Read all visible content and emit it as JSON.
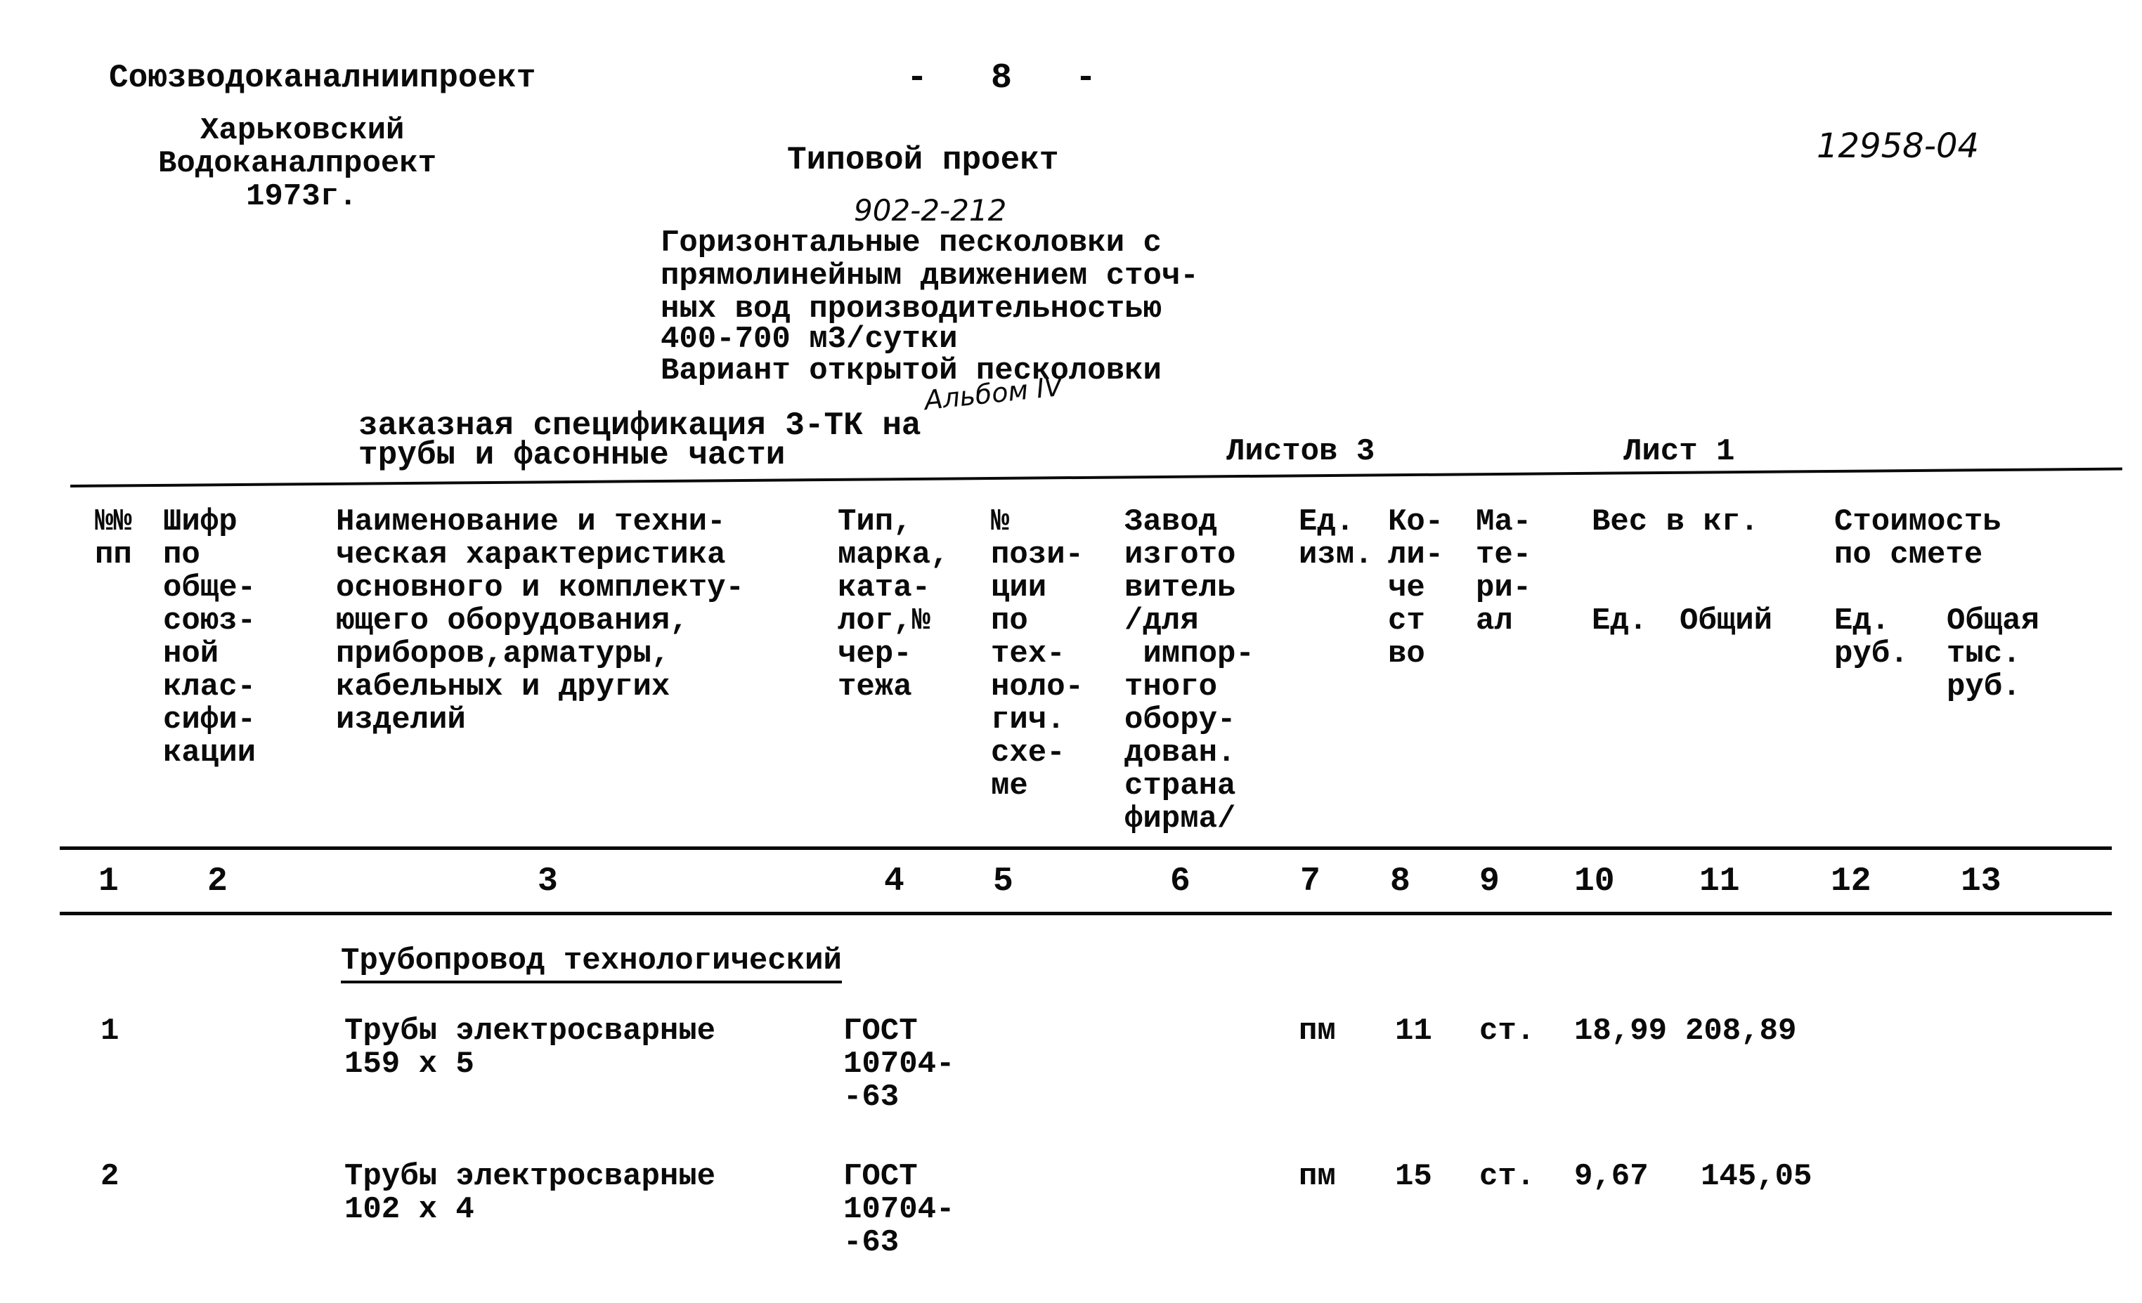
{
  "header": {
    "organization": "Союзводоканалниипроект",
    "page_number": "-   8   -",
    "branch_lines": [
      "Харьковский",
      "Водоканалпроект",
      "1973г."
    ],
    "doc_type": "Типовой проект",
    "project_number_handwritten": "902-2-212",
    "archive_code_handwritten": "12958-04",
    "title_lines": [
      "Горизонтальные песколовки с",
      "прямолинейным движением сточ-",
      "ных вод производительностью",
      "400-700 м3/сутки",
      "Вариант открытой песколовки"
    ],
    "album_handwritten": "Альбом IV",
    "spec_title_lines": [
      "заказная спецификация 3-ТК на",
      "трубы и фасонные части"
    ],
    "sheets_total": "Листов 3",
    "sheet_current": "Лист 1"
  },
  "table": {
    "columns": [
      {
        "num": "1",
        "header": "№№\nпп"
      },
      {
        "num": "2",
        "header": "Шифр\nпо\nобще-\nсоюз-\nной\nклас-\nсифи-\nкации"
      },
      {
        "num": "3",
        "header": "Наименование и техни-\nческая характеристика\nосновного и комплекту-\nющего оборудования,\nприборов,арматуры,\nкабельных и других\nизделий"
      },
      {
        "num": "4",
        "header": "Тип,\nмарка,\nката-\nлог,№\nчер-\nтежа"
      },
      {
        "num": "5",
        "header": "№\nпози-\nции\nпо\nтех-\nноло-\nгич.\nсхе-\nме"
      },
      {
        "num": "6",
        "header": "Завод\nизгото\nвитель\n/для\n импор-\nтного\nобору-\nдован.\nстрана\nфирма/"
      },
      {
        "num": "7",
        "header": "Ед.\nизм."
      },
      {
        "num": "8",
        "header": "Ко-\nли-\nче\nст\nво"
      },
      {
        "num": "9",
        "header": "Ма-\nте-\nри-\nал"
      },
      {
        "num": "10",
        "header": "Ед."
      },
      {
        "num": "11",
        "header": "Общий"
      },
      {
        "num": "12",
        "header": "Ед.\nруб."
      },
      {
        "num": "13",
        "header": "Общая\nтыс.\nруб."
      }
    ],
    "group_headers": {
      "weight": "Вес в кг.",
      "cost": "Стоимость\nпо смете"
    },
    "section_title": "Трубопровод технологический",
    "rows": [
      {
        "pp": "1",
        "code": "",
        "name": "Трубы электросварные\n159 х 5",
        "type": "ГОСТ\n10704-\n-63",
        "position": "",
        "manufacturer": "",
        "unit": "пм",
        "quantity": "11",
        "material": "ст.",
        "weight_unit": "18,99",
        "weight_total": "208,89",
        "cost_unit": "",
        "cost_total": ""
      },
      {
        "pp": "2",
        "code": "",
        "name": "Трубы электросварные\n102 х 4",
        "type": "ГОСТ\n10704-\n-63",
        "position": "",
        "manufacturer": "",
        "unit": "пм",
        "quantity": "15",
        "material": "ст.",
        "weight_unit": "9,67",
        "weight_total": "145,05",
        "cost_unit": "",
        "cost_total": ""
      }
    ]
  }
}
